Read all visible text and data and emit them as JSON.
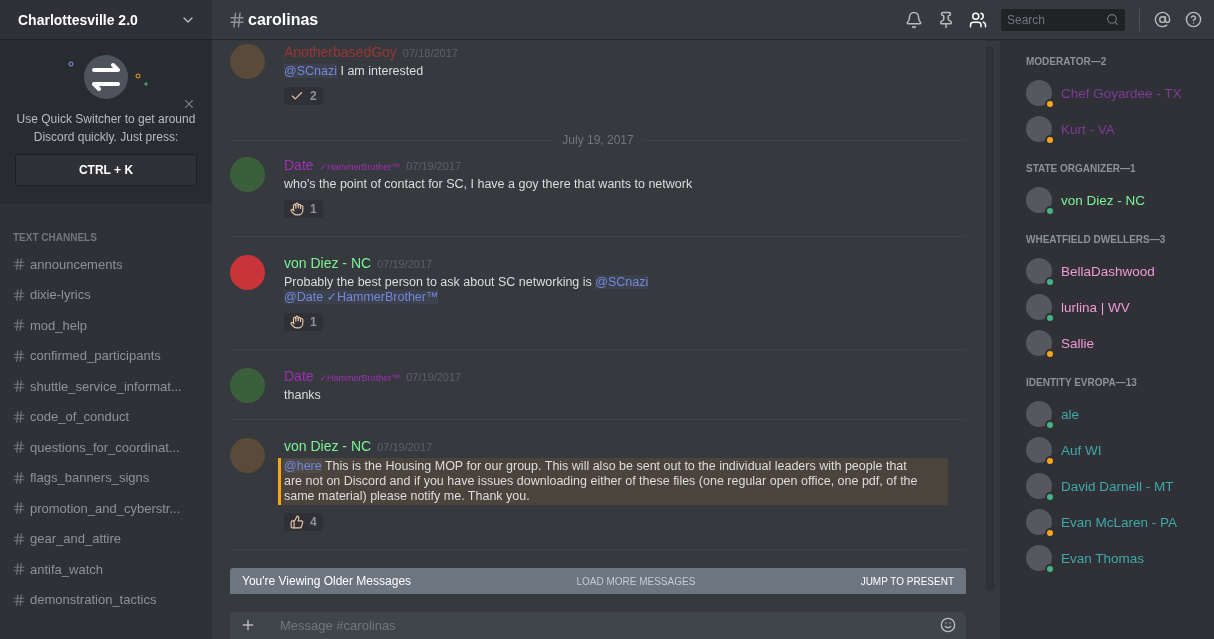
{
  "server": {
    "name": "Charlottesville 2.0"
  },
  "quick_switcher": {
    "text": "Use Quick Switcher to get around Discord quickly. Just press:",
    "shortcut": "CTRL + K"
  },
  "channels": {
    "heading": "TEXT CHANNELS",
    "items": [
      {
        "name": "announcements",
        "selected": false
      },
      {
        "name": "dixie-lyrics",
        "selected": false
      },
      {
        "name": "mod_help",
        "selected": false
      },
      {
        "name": "confirmed_participants",
        "selected": false
      },
      {
        "name": "shuttle_service_informat...",
        "selected": false
      },
      {
        "name": "code_of_conduct",
        "selected": false
      },
      {
        "name": "questions_for_coordinat...",
        "selected": false
      },
      {
        "name": "flags_banners_signs",
        "selected": false
      },
      {
        "name": "promotion_and_cyberstr...",
        "selected": false
      },
      {
        "name": "gear_and_attire",
        "selected": false
      },
      {
        "name": "antifa_watch",
        "selected": false
      },
      {
        "name": "demonstration_tactics",
        "selected": false
      }
    ]
  },
  "header": {
    "channel": "carolinas",
    "search_placeholder": "Search"
  },
  "messages": [
    {
      "kind": "message",
      "author": "AnotherbasedGoy",
      "color": "#9b3535",
      "timestamp": "07/18/2017",
      "highlighted": false,
      "segments": [
        {
          "kind": "mention",
          "text": "@SCnazi"
        },
        {
          "kind": "text",
          "text": " I am interested"
        }
      ],
      "reaction": {
        "kind": "check",
        "count": "2"
      }
    },
    {
      "kind": "divider",
      "text": "July 19, 2017"
    },
    {
      "kind": "message",
      "author": "Date",
      "tag": "✓HammerBrother™",
      "color": "#a12fb4",
      "timestamp": "07/19/2017",
      "highlighted": false,
      "segments": [
        {
          "kind": "text",
          "text": "who's the point of contact for SC, I have a goy there that wants to network"
        }
      ],
      "reaction": {
        "kind": "hand",
        "count": "1"
      }
    },
    {
      "kind": "message",
      "author": "von Diez - NC",
      "color": "#7cf494",
      "timestamp": "07/19/2017",
      "highlighted": false,
      "segments": [
        {
          "kind": "text",
          "text": "Probably the best person to ask about SC networking is "
        },
        {
          "kind": "mention",
          "text": "@SCnazi"
        },
        {
          "kind": "break"
        },
        {
          "kind": "mention",
          "text": "@Date ✓HammerBrother™"
        }
      ],
      "reaction": {
        "kind": "hand",
        "count": "1"
      }
    },
    {
      "kind": "message",
      "author": "Date",
      "tag": "✓HammerBrother™",
      "color": "#a12fb4",
      "timestamp": "07/19/2017",
      "highlighted": false,
      "segments": [
        {
          "kind": "text",
          "text": "thanks"
        }
      ]
    },
    {
      "kind": "message",
      "author": "von Diez - NC",
      "color": "#7cf494",
      "timestamp": "07/19/2017",
      "highlighted": true,
      "segments": [
        {
          "kind": "mention",
          "text": "@here"
        },
        {
          "kind": "text",
          "text": " This is the Housing MOP for our group. This will also be sent out to the individual leaders with people that are not on Discord and if you have issues downloading either of these files (one regular open office, one pdf, of the same material) please notify me. Thank you."
        }
      ],
      "reaction": {
        "kind": "thumb",
        "count": "4"
      }
    }
  ],
  "older_bar": {
    "text": "You're Viewing Older Messages",
    "load": "LOAD MORE MESSAGES",
    "jump": "JUMP TO PRESENT"
  },
  "composer": {
    "placeholder": "Message #carolinas"
  },
  "member_groups": [
    {
      "title": "MODERATOR—2",
      "color": "#7d3c98",
      "members": [
        {
          "name": "Chef Goyardee - TX",
          "color": "#faa61a"
        },
        {
          "name": "Kurt - VA",
          "color": "#faa61a"
        }
      ]
    },
    {
      "title": "STATE ORGANIZER—1",
      "color": "#7cf494",
      "members": [
        {
          "name": "von Diez - NC",
          "color": "#43b581"
        }
      ]
    },
    {
      "title": "WHEATFIELD DWELLERS—3",
      "color": "#f19ad6",
      "members": [
        {
          "name": "BellaDashwood",
          "color": "#43b581"
        },
        {
          "name": "lurlina | WV",
          "color": "#43b581"
        },
        {
          "name": "Sallie",
          "color": "#faa61a"
        }
      ]
    },
    {
      "title": "IDENTITY EVROPA—13",
      "color": "#3fa8a8",
      "members": [
        {
          "name": "ale",
          "color": "#43b581"
        },
        {
          "name": "Auf WI",
          "color": "#faa61a"
        },
        {
          "name": "David Darnell - MT",
          "color": "#43b581"
        },
        {
          "name": "Evan McLaren - PA",
          "color": "#faa61a"
        },
        {
          "name": "Evan Thomas",
          "color": "#43b581"
        }
      ]
    }
  ]
}
